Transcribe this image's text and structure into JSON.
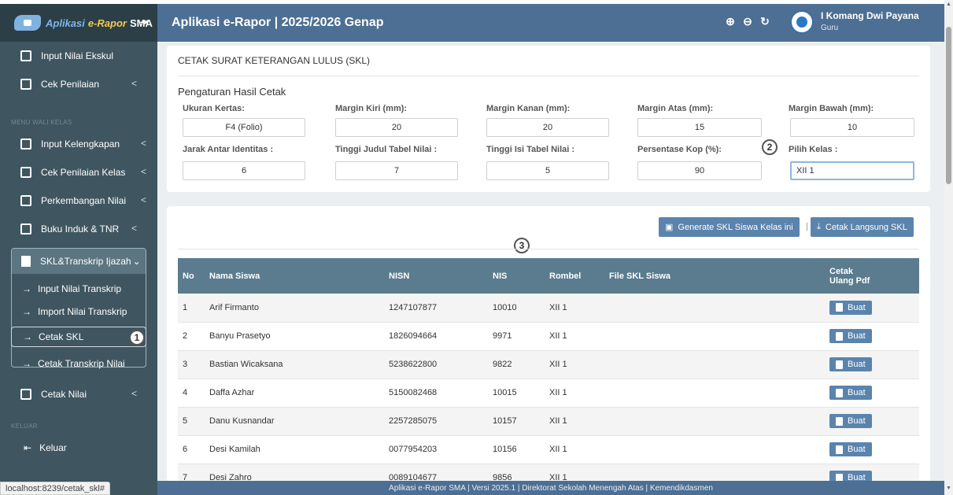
{
  "header": {
    "brand_part1": "Aplikasi",
    "brand_part2": "e-Rapor",
    "brand_part3": "SMA",
    "pin_symbol": "⇥",
    "title": "Aplikasi e-Rapor | 2025/2026 Genap",
    "user_name": "I Komang Dwi Payana",
    "user_role": "Guru"
  },
  "sidebar": {
    "items_top": [
      {
        "label": "Input Nilai Ekskul",
        "icon": "plus-square-icon"
      },
      {
        "label": "Cek Penilaian",
        "icon": "chart-icon",
        "chevron": "<"
      }
    ],
    "section_wali": "MENU WALI KELAS",
    "items_wali": [
      {
        "label": "Input Kelengkapan",
        "icon": "checkbox-icon",
        "chevron": "<"
      },
      {
        "label": "Cek Penilaian Kelas",
        "icon": "trend-icon",
        "chevron": "<"
      },
      {
        "label": "Perkembangan Nilai",
        "icon": "bar-chart-icon",
        "chevron": "<"
      },
      {
        "label": "Buku Induk & TNR",
        "icon": "book-icon",
        "chevron": "<"
      }
    ],
    "group": {
      "label": "SKL&Transkrip Ijazah",
      "chevron": "⌄",
      "subs": [
        {
          "label": "Input Nilai Transkrip"
        },
        {
          "label": "Import Nilai Transkrip"
        },
        {
          "label": "Cetak SKL"
        },
        {
          "label": "Cetak Transkrip Nilai"
        }
      ]
    },
    "item_cetak": {
      "label": "Cetak Nilai",
      "chevron": "<"
    },
    "section_keluar": "KELUAR",
    "item_keluar": {
      "label": "Keluar"
    }
  },
  "badges": {
    "one": "1",
    "two": "2",
    "three": "3"
  },
  "status_url": "localhost:8239/cetak_skl#",
  "panel": {
    "title": "CETAK SURAT KETERANGAN LULUS (SKL)",
    "section": "Pengaturan Hasil Cetak",
    "fields_row1": [
      {
        "label": "Ukuran Kertas:",
        "value": "F4 (Folio)"
      },
      {
        "label": "Margin Kiri (mm):",
        "value": "20"
      },
      {
        "label": "Margin Kanan (mm):",
        "value": "20"
      },
      {
        "label": "Margin Atas (mm):",
        "value": "15"
      },
      {
        "label": "Margin Bawah (mm):",
        "value": "10"
      }
    ],
    "fields_row2": [
      {
        "label": "Jarak Antar Identitas :",
        "value": "6"
      },
      {
        "label": "Tinggi Judul Tabel Nilai :",
        "value": "7"
      },
      {
        "label": "Tinggi Isi Tabel Nilai :",
        "value": "5"
      },
      {
        "label": "Persentase Kop (%):",
        "value": "90"
      },
      {
        "label": "Pilih Kelas :",
        "value": "XII 1"
      }
    ]
  },
  "actions": {
    "generate": "Generate SKL Siswa Kelas ini",
    "separator": "|",
    "print": "Cetak Langsung SKL"
  },
  "table": {
    "headers": [
      "No",
      "Nama Siswa",
      "NISN",
      "NIS",
      "Rombel",
      "File SKL Siswa",
      "Cetak Ulang Pdf"
    ],
    "header_last_line1": "Cetak",
    "header_last_line2": "Ulang Pdf",
    "button_label": "Buat",
    "rows": [
      {
        "no": "1",
        "nama": "Arif Firmanto",
        "nisn": "1247107877",
        "nis": "10010",
        "rombel": "XII 1",
        "file": ""
      },
      {
        "no": "2",
        "nama": "Banyu Prasetyo",
        "nisn": "1826094664",
        "nis": "9971",
        "rombel": "XII 1",
        "file": ""
      },
      {
        "no": "3",
        "nama": "Bastian Wicaksana",
        "nisn": "5238622800",
        "nis": "9822",
        "rombel": "XII 1",
        "file": ""
      },
      {
        "no": "4",
        "nama": "Daffa Azhar",
        "nisn": "5150082468",
        "nis": "10015",
        "rombel": "XII 1",
        "file": ""
      },
      {
        "no": "5",
        "nama": "Danu Kusnandar",
        "nisn": "2257285075",
        "nis": "10157",
        "rombel": "XII 1",
        "file": ""
      },
      {
        "no": "6",
        "nama": "Desi Kamilah",
        "nisn": "0077954203",
        "nis": "10156",
        "rombel": "XII 1",
        "file": ""
      },
      {
        "no": "7",
        "nama": "Desi Zahro",
        "nisn": "0089104677",
        "nis": "9856",
        "rombel": "XII 1",
        "file": ""
      }
    ]
  },
  "footer": "Aplikasi e-Rapor SMA | Versi 2025.1 | Direktorat Sekolah Menengah Atas | Kemendikdasmen"
}
